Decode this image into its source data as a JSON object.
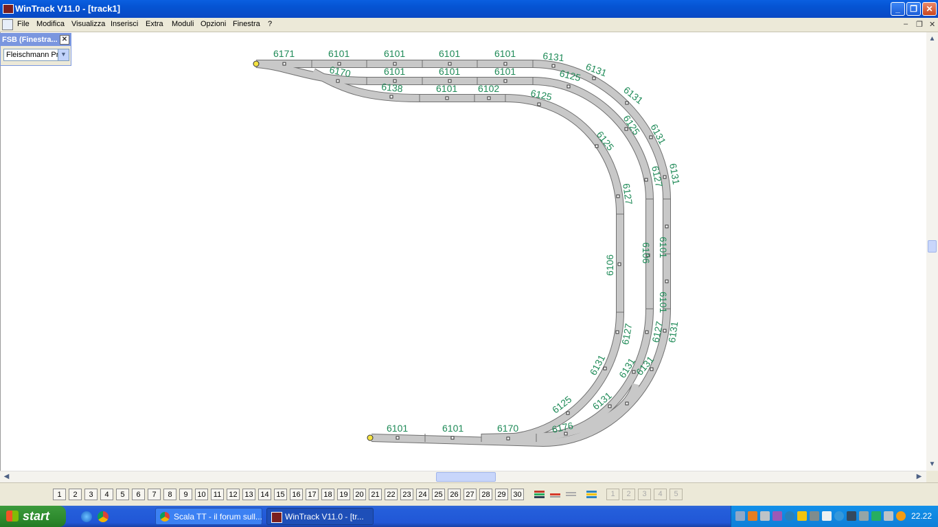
{
  "window": {
    "title": "WinTrack  V11.0 - [track1]"
  },
  "menu": {
    "items": [
      "File",
      "Modifica",
      "Visualizza",
      "Inserisci",
      "Extra",
      "Moduli",
      "Opzioni",
      "Finestra",
      "?"
    ]
  },
  "fsb": {
    "title": "FSB (Finestra...",
    "selected": "Fleischmann Pr"
  },
  "track": {
    "colors": {
      "rail": "#c8c8c8",
      "label": "#1e8a57"
    },
    "labels": {
      "l01": "6171",
      "l02": "6101",
      "l03": "6101",
      "l04": "6101",
      "l05": "6101",
      "l06": "6131",
      "l07": "6131",
      "l08": "6170",
      "l09": "6101",
      "l10": "6101",
      "l11": "6101",
      "l12": "6125",
      "l13": "6131",
      "l14": "6138",
      "l15": "6101",
      "l16": "6102",
      "l17": "6125",
      "l18": "6125",
      "l19": "6131",
      "l20": "6125",
      "l21": "6127",
      "l22": "6131",
      "l23": "6127",
      "l24": "6101",
      "l25": "6106",
      "l26": "6106",
      "l27": "6101",
      "l28": "6127",
      "l29": "6131",
      "l30": "6127",
      "l31": "6131",
      "l32": "6131",
      "l33": "6131",
      "l34": "6125",
      "l35": "6131",
      "l36": "6101",
      "l37": "6101",
      "l38": "6170",
      "l39": "6176"
    }
  },
  "toolbar": {
    "layers": [
      "1",
      "2",
      "3",
      "4",
      "5",
      "6",
      "7",
      "8",
      "9",
      "10",
      "11",
      "12",
      "13",
      "14",
      "15",
      "16",
      "17",
      "18",
      "19",
      "20",
      "21",
      "22",
      "23",
      "24",
      "25",
      "26",
      "27",
      "28",
      "29",
      "30"
    ],
    "disabled": [
      "1",
      "2",
      "3",
      "4",
      "5"
    ]
  },
  "taskbar": {
    "start": "start",
    "tasks": [
      "Scala TT - il forum sull...",
      "WinTrack  V11.0 - [tr..."
    ],
    "clock": "22.22"
  }
}
